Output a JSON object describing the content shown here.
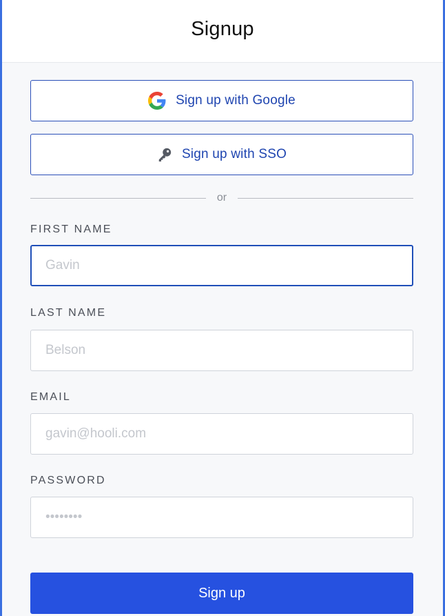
{
  "header": {
    "title": "Signup"
  },
  "oauth": {
    "google_label": "Sign up with Google",
    "sso_label": "Sign up with SSO",
    "google_icon": "google-g-icon",
    "sso_icon": "key-icon"
  },
  "divider": {
    "text": "or"
  },
  "form": {
    "first_name": {
      "label": "FIRST NAME",
      "placeholder": "Gavin",
      "value": ""
    },
    "last_name": {
      "label": "LAST NAME",
      "placeholder": "Belson",
      "value": ""
    },
    "email": {
      "label": "EMAIL",
      "placeholder": "gavin@hooli.com",
      "value": ""
    },
    "password": {
      "label": "PASSWORD",
      "placeholder": "••••••••",
      "value": ""
    }
  },
  "submit": {
    "label": "Sign up"
  },
  "colors": {
    "accent": "#2651e0",
    "outline_text": "#1f45b0",
    "frame_border": "#3a6fe0",
    "background": "#f7f8fa"
  }
}
